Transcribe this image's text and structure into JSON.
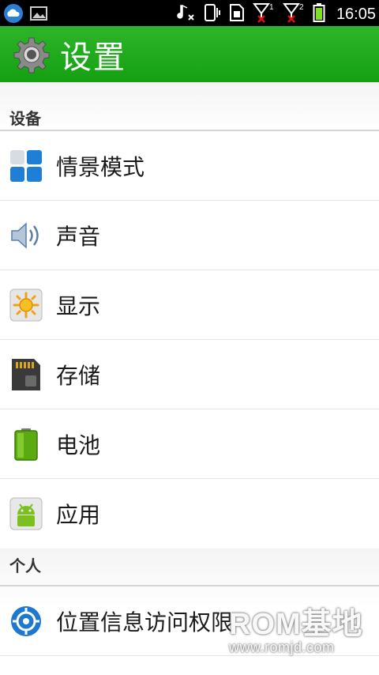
{
  "status_bar": {
    "time": "16:05",
    "left_icons": [
      "cloud-icon",
      "image-icon"
    ],
    "right_icons": [
      "music-mute-icon",
      "vibrate-icon",
      "sim-icon",
      "signal-1-icon",
      "signal-2-icon",
      "battery-icon"
    ],
    "sim1_label": "1",
    "sim2_label": "2"
  },
  "action_bar": {
    "title": "设置",
    "icon": "settings-gear-icon",
    "color": "#1ea81b"
  },
  "sections": [
    {
      "header": "设备",
      "items": [
        {
          "label": "情景模式",
          "icon": "profiles-icon"
        },
        {
          "label": "声音",
          "icon": "sound-icon"
        },
        {
          "label": "显示",
          "icon": "display-icon"
        },
        {
          "label": "存储",
          "icon": "storage-icon"
        },
        {
          "label": "电池",
          "icon": "battery-icon"
        },
        {
          "label": "应用",
          "icon": "apps-icon"
        }
      ]
    },
    {
      "header": "个人",
      "items": [
        {
          "label": "位置信息访问权限",
          "icon": "location-icon"
        }
      ]
    }
  ],
  "watermark": {
    "line1": "ROM基地",
    "line2": "www.romjd.com"
  }
}
